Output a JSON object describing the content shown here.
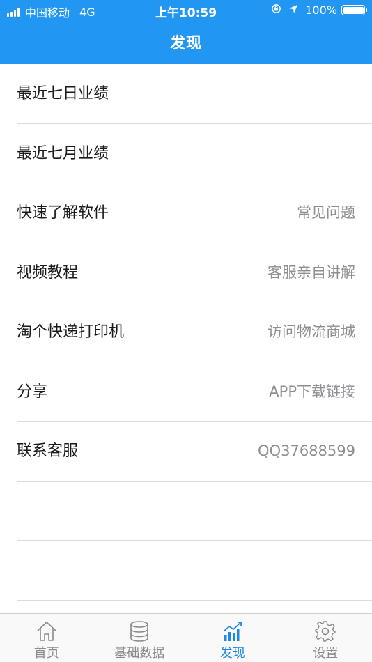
{
  "status_bar": {
    "carrier": "中国移动",
    "network": "4G",
    "time": "上午10:59",
    "battery": "100%"
  },
  "nav": {
    "title": "发现"
  },
  "list": [
    {
      "label": "最近七日业绩",
      "detail": ""
    },
    {
      "label": "最近七月业绩",
      "detail": ""
    },
    {
      "label": "快速了解软件",
      "detail": "常见问题"
    },
    {
      "label": "视频教程",
      "detail": "客服亲自讲解"
    },
    {
      "label": "淘个快递打印机",
      "detail": "访问物流商城"
    },
    {
      "label": "分享",
      "detail": "APP下载链接"
    },
    {
      "label": "联系客服",
      "detail": "QQ37688599"
    },
    {
      "label": "",
      "detail": ""
    },
    {
      "label": "",
      "detail": ""
    }
  ],
  "tabs": [
    {
      "label": "首页",
      "icon": "home-icon",
      "active": false
    },
    {
      "label": "基础数据",
      "icon": "database-icon",
      "active": false
    },
    {
      "label": "发现",
      "icon": "chart-icon",
      "active": true
    },
    {
      "label": "设置",
      "icon": "gear-icon",
      "active": false
    }
  ],
  "colors": {
    "header": "#2196f3",
    "active_tab": "#1e88e5",
    "inactive_tab": "#8a8a8a"
  }
}
